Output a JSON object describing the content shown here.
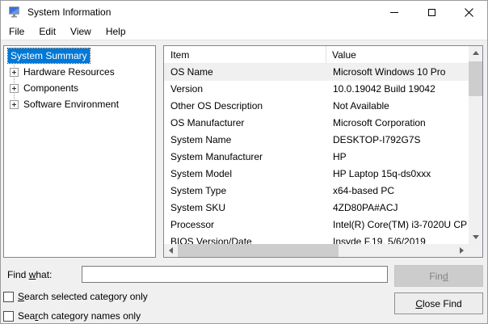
{
  "window": {
    "title": "System Information"
  },
  "menu": {
    "items": [
      "File",
      "Edit",
      "View",
      "Help"
    ]
  },
  "tree": {
    "items": [
      {
        "label": "System Summary",
        "selected": true,
        "expandable": false
      },
      {
        "label": "Hardware Resources",
        "selected": false,
        "expandable": true
      },
      {
        "label": "Components",
        "selected": false,
        "expandable": true
      },
      {
        "label": "Software Environment",
        "selected": false,
        "expandable": true
      }
    ]
  },
  "table": {
    "columns": {
      "item": "Item",
      "value": "Value"
    },
    "highlighted_row_index": 0,
    "rows": [
      {
        "item": "OS Name",
        "value": "Microsoft Windows 10 Pro"
      },
      {
        "item": "Version",
        "value": "10.0.19042 Build 19042"
      },
      {
        "item": "Other OS Description",
        "value": "Not Available"
      },
      {
        "item": "OS Manufacturer",
        "value": "Microsoft Corporation"
      },
      {
        "item": "System Name",
        "value": "DESKTOP-I792G7S"
      },
      {
        "item": "System Manufacturer",
        "value": "HP"
      },
      {
        "item": "System Model",
        "value": "HP Laptop 15q-ds0xxx"
      },
      {
        "item": "System Type",
        "value": "x64-based PC"
      },
      {
        "item": "System SKU",
        "value": "4ZD80PA#ACJ"
      },
      {
        "item": "Processor",
        "value": "Intel(R) Core(TM) i3-7020U CP"
      },
      {
        "item": "BIOS Version/Date",
        "value": "Insyde F.19, 5/6/2019"
      }
    ]
  },
  "find": {
    "label": {
      "pre": "Find ",
      "key": "w",
      "post": "hat:"
    },
    "input_value": "",
    "find_button": {
      "pre": "Fin",
      "key": "d",
      "post": "",
      "enabled": false
    },
    "close_button": {
      "pre": "",
      "key": "C",
      "post": "lose Find",
      "enabled": true
    },
    "checkbox_selected_category": {
      "pre": "",
      "key": "S",
      "post": "earch selected category only",
      "checked": false
    },
    "checkbox_category_names": {
      "pre": "Sea",
      "key": "r",
      "post": "ch category names only",
      "checked": false
    }
  },
  "colors": {
    "selection_blue": "#0078d7",
    "row_highlight": "#f0f0f0",
    "dialog_background": "#f0f0f0",
    "panel_border": "#828790",
    "scrollbar_thumb": "#cdcdcd",
    "disabled_button_bg": "#cccccc",
    "disabled_button_text": "#838383"
  }
}
